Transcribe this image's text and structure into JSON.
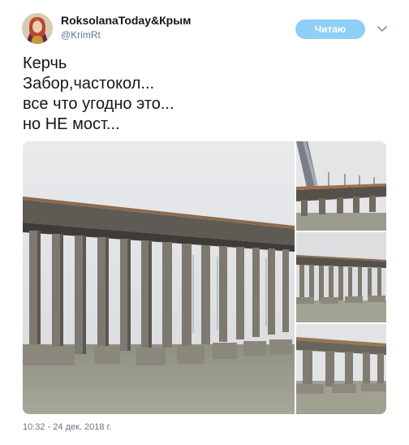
{
  "author": {
    "name": "RoksolanaToday&Крым",
    "handle": "@KrimRt",
    "avatar_icon": "avatar-portrait-icon"
  },
  "follow_button": {
    "label": "Читаю",
    "color": "#8ecff5"
  },
  "more_icon": "chevron-down-icon",
  "tweet_text": {
    "lines": [
      "Керчь",
      "Забор,частокол...",
      "все что угодно это...",
      "но НЕ мост..."
    ]
  },
  "media": {
    "photos": [
      "photo-bridge-main",
      "photo-bridge-top-right",
      "photo-bridge-middle-right",
      "photo-bridge-bottom-right"
    ]
  },
  "timestamp": "10:32 - 24 дек. 2018 г.",
  "colors": {
    "text": "#14171a",
    "secondary": "#657786",
    "accent": "#1da1f2"
  }
}
